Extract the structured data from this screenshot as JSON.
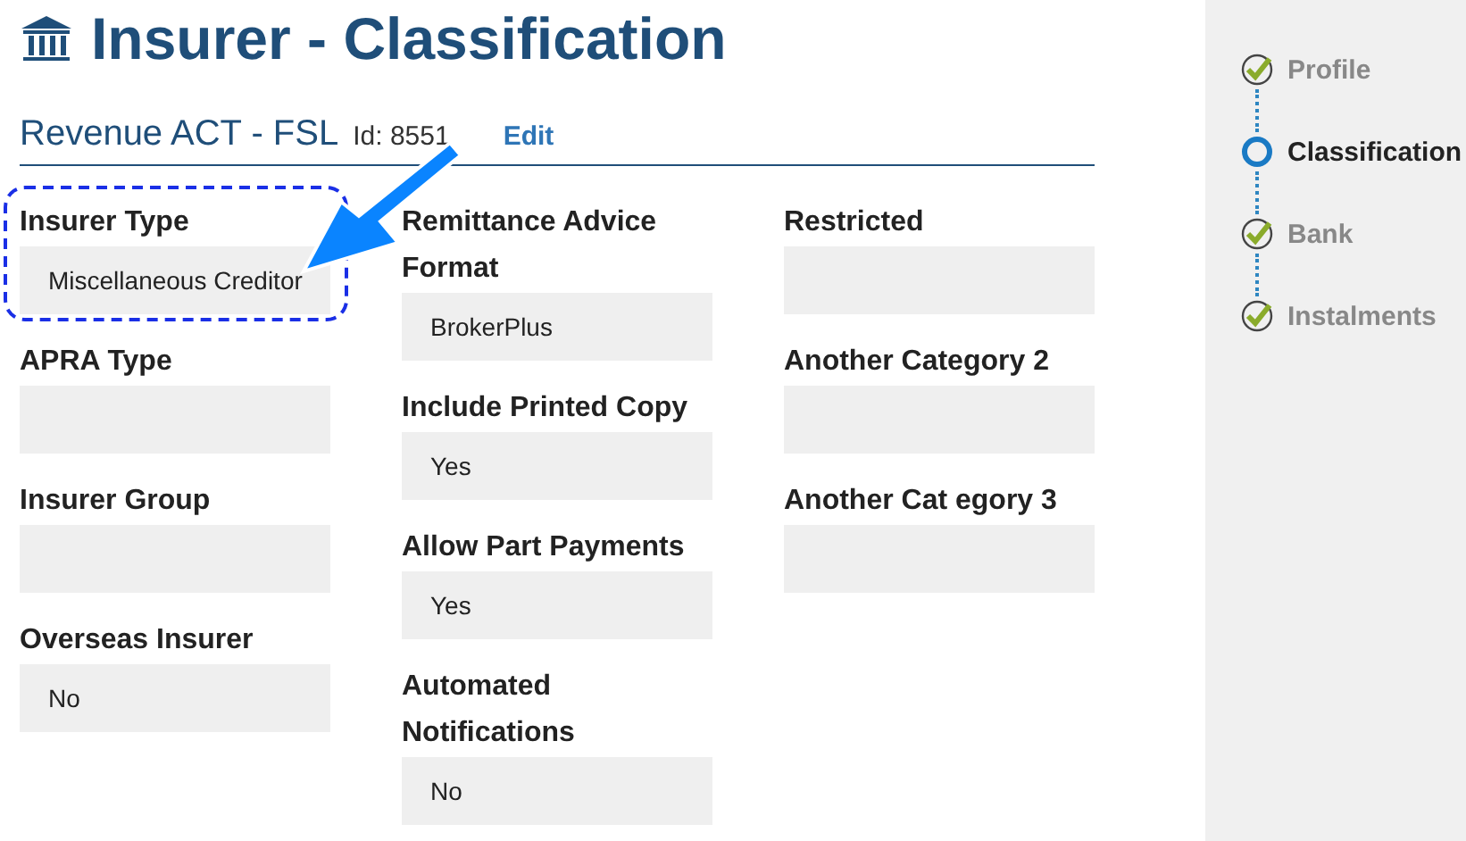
{
  "page": {
    "title": "Insurer - Classification"
  },
  "record": {
    "name": "Revenue ACT - FSL",
    "id": "Id: 8551",
    "edit": "Edit"
  },
  "columns": [
    {
      "fields": [
        {
          "label": "Insurer Type",
          "value": "Miscellaneous Creditor",
          "highlighted": true
        },
        {
          "label": "APRA Type",
          "highlighted": false
        },
        {
          "label": "Insurer Group",
          "highlighted": false
        },
        {
          "label": "Overseas Insurer",
          "value": "No",
          "highlighted": false
        }
      ]
    },
    {
      "fields": [
        {
          "label": "Remittance Advice Format",
          "value": "BrokerPlus",
          "highlighted": false
        },
        {
          "label": "Include Printed Copy",
          "value": "Yes",
          "highlighted": false
        },
        {
          "label": "Allow Part Payments",
          "value": "Yes",
          "highlighted": false
        },
        {
          "label": "Automated Notifications",
          "value": "No",
          "highlighted": false
        }
      ]
    },
    {
      "fields": [
        {
          "label": "Restricted",
          "highlighted": false
        },
        {
          "label": "Another Category 2",
          "highlighted": false
        },
        {
          "label": "Another Cat egory 3",
          "highlighted": false
        }
      ]
    }
  ],
  "steps": [
    {
      "label": "Profile",
      "selected": false
    },
    {
      "label": "Classification",
      "selected": true
    },
    {
      "label": "Bank",
      "selected": false
    },
    {
      "label": "Instalments",
      "selected": false
    }
  ]
}
